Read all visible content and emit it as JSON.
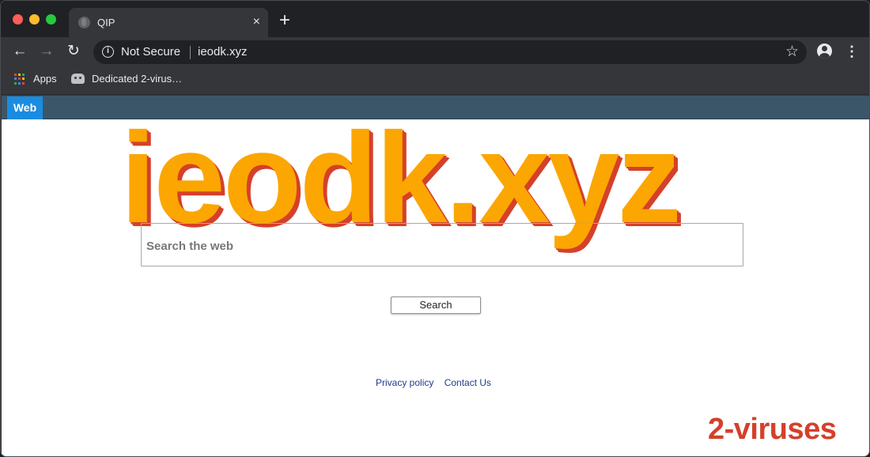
{
  "tab": {
    "title": "QIP",
    "close_glyph": "×",
    "new_tab_glyph": "+"
  },
  "toolbar": {
    "back_glyph": "←",
    "forward_glyph": "→",
    "reload_glyph": "↻",
    "security_label": "Not Secure",
    "url": "ieodk.xyz",
    "star_glyph": "☆",
    "menu_glyph": "⋮"
  },
  "bookmarks": {
    "apps_label": "Apps",
    "items": [
      {
        "label": "Dedicated 2-virus…"
      }
    ],
    "apps_colors": [
      "#ea4335",
      "#fbbc05",
      "#34a853",
      "#4285f4",
      "#ea4335",
      "#fbbc05",
      "#34a853",
      "#4285f4",
      "#ea4335"
    ]
  },
  "page": {
    "web_tab_label": "Web",
    "logo_text": "ieodk.xyz",
    "search_placeholder": "Search the web",
    "search_button_label": "Search",
    "footer_links": [
      "Privacy policy",
      "Contact Us"
    ],
    "watermark": "2-viruses"
  },
  "colors": {
    "logo_fill": "#fca602",
    "logo_shadow": "#d5402a",
    "web_tab": "#1a8ce0",
    "web_bar": "#3c5669",
    "link": "#1f3c8c",
    "watermark": "#d4402a"
  },
  "icons": [
    "back-arrow-icon",
    "forward-arrow-icon",
    "reload-icon",
    "info-icon",
    "star-icon",
    "profile-icon",
    "menu-icon",
    "apps-icon",
    "bookmark-favicon",
    "globe-favicon"
  ]
}
